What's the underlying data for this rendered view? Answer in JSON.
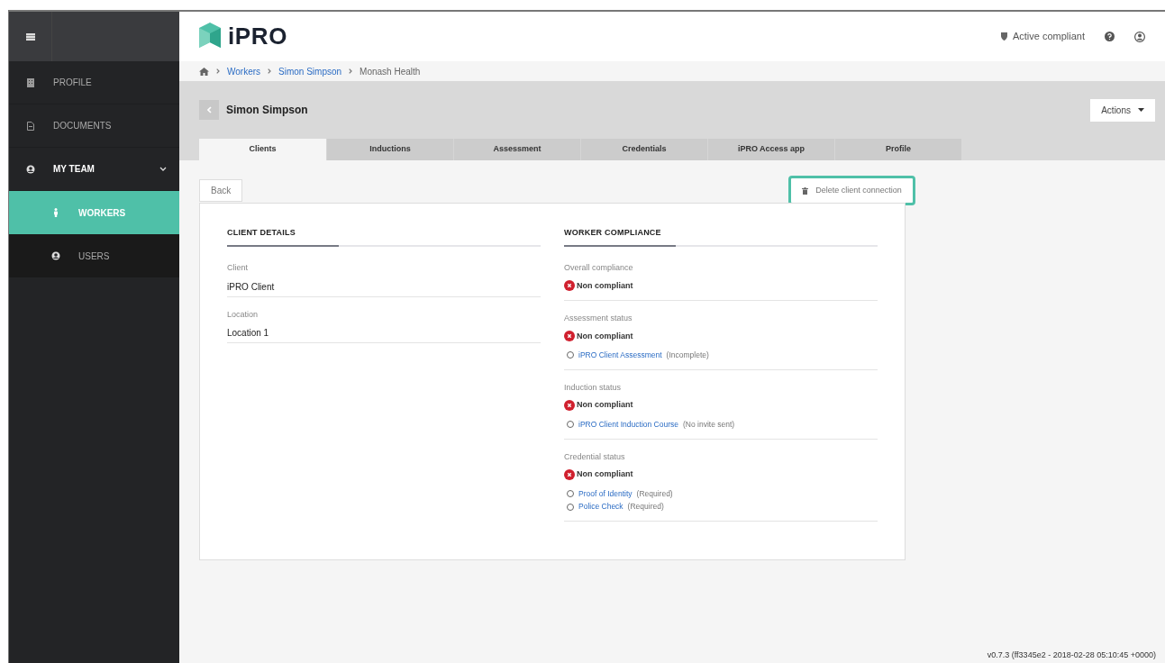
{
  "sidebar": {
    "items": [
      {
        "kind": "item",
        "label": "PROFILE",
        "selected": false
      },
      {
        "kind": "item",
        "label": "DOCUMENTS",
        "selected": false
      },
      {
        "kind": "group",
        "label": "MY TEAM",
        "selected": false,
        "expanded": true,
        "children": [
          {
            "kind": "subitem",
            "label": "WORKERS",
            "selected": true
          },
          {
            "kind": "subitem",
            "label": "USERS",
            "selected": false
          }
        ]
      }
    ]
  },
  "header": {
    "logo": "iPRO",
    "compliance_badge": "Active compliant"
  },
  "breadcrumb": [
    {
      "label": "Workers",
      "link": true
    },
    {
      "label": "Simon Simpson",
      "link": true
    },
    {
      "label": "Monash Health",
      "link": false
    }
  ],
  "page_title": "Simon Simpson",
  "actions_button": "Actions",
  "tabs": [
    {
      "label": "Clients",
      "selected": true
    },
    {
      "label": "Inductions",
      "selected": false
    },
    {
      "label": "Assessment",
      "selected": false
    },
    {
      "label": "Credentials",
      "selected": false
    },
    {
      "label": "iPRO Access app",
      "selected": false
    },
    {
      "label": "Profile",
      "selected": false
    }
  ],
  "back_button": "Back",
  "delete_button": {
    "label": "Delete client connection",
    "highlighted": true
  },
  "client_details": {
    "title": "CLIENT DETAILS",
    "fields": [
      {
        "label": "Client",
        "value": "iPRO Client"
      },
      {
        "label": "Location",
        "value": "Location 1"
      }
    ]
  },
  "worker_compliance": {
    "title": "WORKER COMPLIANCE",
    "sections": [
      {
        "label": "Overall compliance",
        "status": "Non compliant",
        "compliant": false
      },
      {
        "label": "Assessment status",
        "status": "Non compliant",
        "compliant": false,
        "items": [
          {
            "link": "iPRO Client Assessment",
            "note": "(Incomplete)",
            "done": false
          }
        ]
      },
      {
        "label": "Induction status",
        "status": "Non compliant",
        "compliant": false,
        "items": [
          {
            "link": "iPRO Client Induction Course",
            "note": "(No invite sent)",
            "done": false
          }
        ]
      },
      {
        "label": "Credential status",
        "status": "Non compliant",
        "compliant": false,
        "items": [
          {
            "link": "Proof of Identity",
            "note": "(Required)",
            "done": false
          },
          {
            "link": "Police Check",
            "note": "(Required)",
            "done": false
          }
        ]
      }
    ]
  },
  "footer": {
    "version": "v0.7.3 (ff3345e2 - 2018-02-28 05:10:45 +0000)"
  }
}
